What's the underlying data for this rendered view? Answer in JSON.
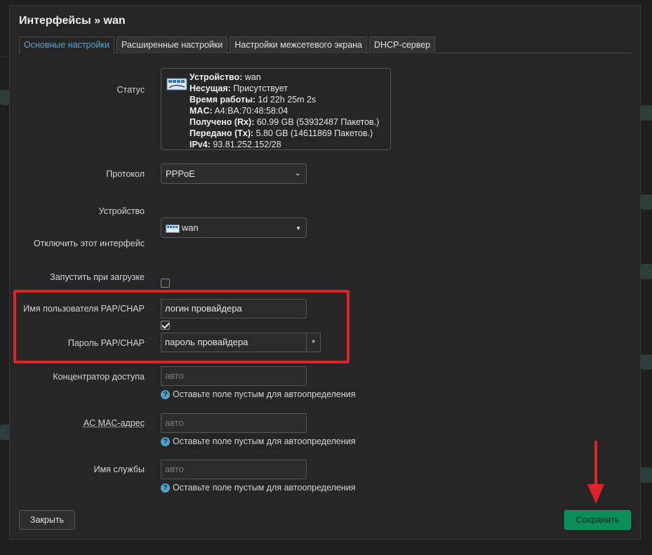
{
  "modal": {
    "title": "Интерфейсы » wan",
    "tabs": [
      {
        "label": "Основные настройки",
        "active": true
      },
      {
        "label": "Расширенные настройки",
        "active": false
      },
      {
        "label": "Настройки межсетевого экрана",
        "active": false
      },
      {
        "label": "DHCP-сервер",
        "active": false
      }
    ]
  },
  "status": {
    "label": "Статус",
    "lines": [
      {
        "key": "Устройство:",
        "value": "wan"
      },
      {
        "key": "Несущая:",
        "value": "Присутствует"
      },
      {
        "key": "Время работы:",
        "value": "1d 22h 25m 2s"
      },
      {
        "key": "MAC:",
        "value": "A4:BA:70:48:58:04"
      },
      {
        "key": "Получено (Rx):",
        "value": "60.99 GB (53932487 Пакетов.)"
      },
      {
        "key": "Передано (Tx):",
        "value": "5.80 GB (14611869 Пакетов.)"
      },
      {
        "key": "IPv4:",
        "value": "93.81.252.152/28"
      }
    ],
    "icon": "network-port-icon"
  },
  "form": {
    "protocol": {
      "label": "Протокол",
      "value": "PPPoE"
    },
    "device": {
      "label": "Устройство",
      "value": "wan"
    },
    "disable": {
      "label": "Отключить этот интерфейс",
      "checked": false
    },
    "autostart": {
      "label": "Запустить при загрузке",
      "checked": true
    },
    "username": {
      "label": "Имя пользователя PAP/CHAP",
      "value": "логин провайдера"
    },
    "password": {
      "label": "Пароль PAP/CHAP",
      "value": "пароль провайдера",
      "reveal": "*"
    },
    "concentrator": {
      "label": "Концентратор доступа",
      "placeholder": "авто",
      "hint": "Оставьте поле пустым для автоопределения"
    },
    "ac_mac": {
      "label": "AC MAC-адрес",
      "placeholder": "авто",
      "hint": "Оставьте поле пустым для автоопределения"
    },
    "service": {
      "label": "Имя службы",
      "placeholder": "авто",
      "hint": "Оставьте поле пустым для автоопределения"
    },
    "help_glyph": "?"
  },
  "buttons": {
    "close": "Закрыть",
    "save": "Сохранить"
  },
  "colors": {
    "accent_tab": "#5ba4d6",
    "save_green": "#0c8e5b",
    "annotation_red": "#e0222b"
  }
}
